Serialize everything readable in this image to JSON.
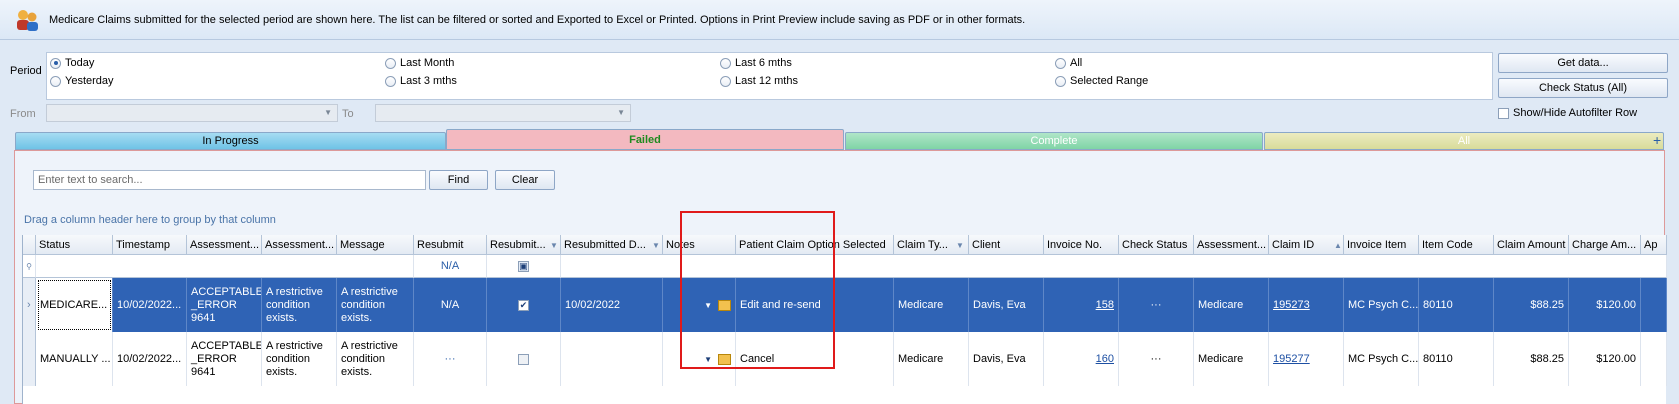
{
  "banner": {
    "text": "Medicare Claims submitted for the selected period are shown here. The list can be filtered or sorted and Exported to Excel or Printed.  Options in Print Preview include saving as PDF or in other formats."
  },
  "period": {
    "label": "Period",
    "options": [
      "Today",
      "Yesterday",
      "Last Month",
      "Last 3 mths",
      "Last 6 mths",
      "Last 12 mths",
      "All",
      "Selected Range"
    ],
    "selected": "Today"
  },
  "buttons": {
    "get_data": "Get data...",
    "check_status": "Check Status (All)",
    "find": "Find",
    "clear": "Clear"
  },
  "range": {
    "from_label": "From",
    "to_label": "To",
    "from_value": "",
    "to_value": ""
  },
  "autofilter": {
    "label": "Show/Hide Autofilter Row",
    "checked": false
  },
  "tabs": [
    {
      "label": "In Progress",
      "color": "#6fc3e6"
    },
    {
      "label": "Failed",
      "color": "#f3b9c0"
    },
    {
      "label": "Complete",
      "color": "#7fd4a6"
    },
    {
      "label": "All",
      "color": "#d8dc9a"
    }
  ],
  "add_tab_icon": "+",
  "search": {
    "placeholder": "Enter text to search..."
  },
  "group_hint": "Drag a column header here to group by that column",
  "columns": [
    "Status",
    "Timestamp",
    "Assessment...",
    "Assessment...",
    "Message",
    "Resubmit",
    "Resubmit...",
    "Resubmitted D...",
    "Notes",
    "Patient Claim Option Selected",
    "Claim Ty...",
    "Client",
    "Invoice No.",
    "Check Status",
    "Assessment...",
    "Claim ID",
    "Invoice Item",
    "Item Code",
    "Claim Amount",
    "Charge Am...",
    "Ap"
  ],
  "filter_row": {
    "resubmit": "N/A"
  },
  "rows": [
    {
      "status": "MEDICARE...",
      "timestamp": "10/02/2022...",
      "assess1": "ACCEPTABLE _ERROR 9641",
      "assess2": "A restrictive condition exists.",
      "message": "A restrictive condition exists.",
      "resubmit": "N/A",
      "resubmitted_checked": true,
      "resubmitted_date": "10/02/2022",
      "option": "Edit and re-send",
      "claim_type": "Medicare",
      "client": "Davis, Eva",
      "invoice": "158",
      "check_status": "···",
      "assess3": "Medicare",
      "claim_id": "195273",
      "invoice_item": "MC Psych C...",
      "item_code": "80110",
      "claim_amount": "$88.25",
      "charge_amount": "$120.00"
    },
    {
      "status": "MANUALLY ...",
      "timestamp": "10/02/2022...",
      "assess1": "ACCEPTABLE _ERROR 9641",
      "assess2": "A restrictive condition exists.",
      "message": "A restrictive condition exists.",
      "resubmit": "···",
      "resubmitted_checked": false,
      "resubmitted_date": "",
      "option": "Cancel",
      "claim_type": "Medicare",
      "client": "Davis, Eva",
      "invoice": "160",
      "check_status": "···",
      "assess3": "Medicare",
      "claim_id": "195277",
      "invoice_item": "MC Psych C...",
      "item_code": "80110",
      "claim_amount": "$88.25",
      "charge_amount": "$120.00"
    }
  ]
}
